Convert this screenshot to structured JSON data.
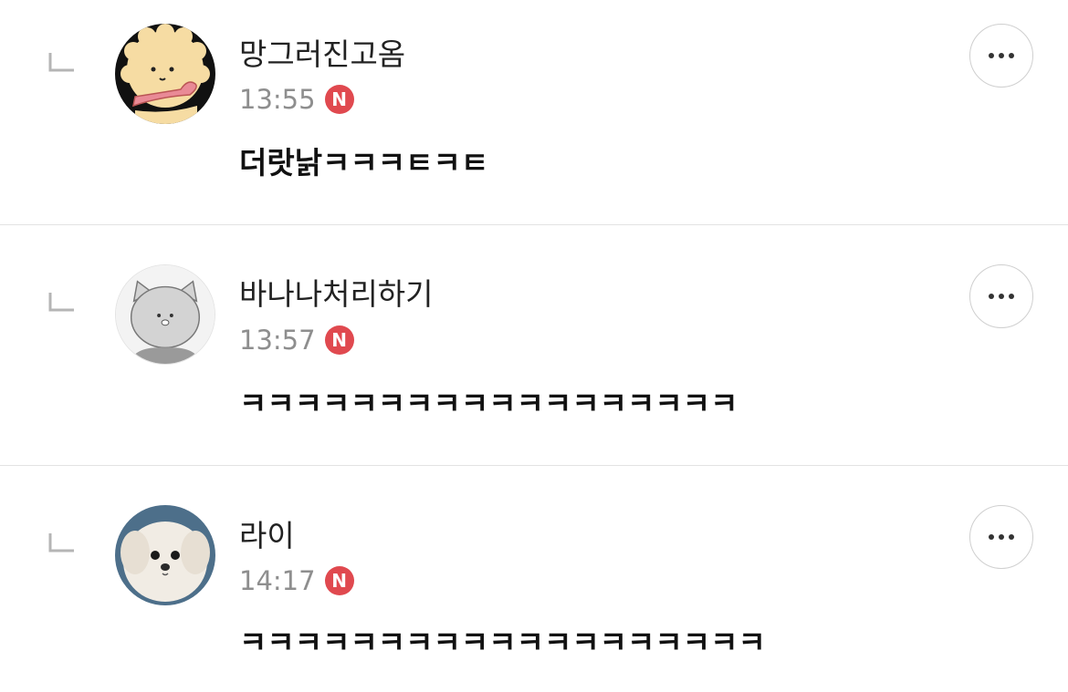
{
  "comments": [
    {
      "username": "망그러진고옴",
      "time": "13:55",
      "new_badge": "N",
      "text": "더랏낡ㅋㅋㅋㅌㅋㅌ",
      "avatar_icon": "cream-bear-avatar"
    },
    {
      "username": "바나나처리하기",
      "time": "13:57",
      "new_badge": "N",
      "text": "ㅋㅋㅋㅋㅋㅋㅋㅋㅋㅋㅋㅋㅋㅋㅋㅋㅋㅋ",
      "avatar_icon": "gray-cat-avatar"
    },
    {
      "username": "라이",
      "time": "14:17",
      "new_badge": "N",
      "text": "ㅋㅋㅋㅋㅋㅋㅋㅋㅋㅋㅋㅋㅋㅋㅋㅋㅋㅋㅋ",
      "avatar_icon": "white-puppy-avatar"
    }
  ],
  "colors": {
    "badge": "#e0494f",
    "divider": "#e3e3e3",
    "time": "#8e8e8e"
  }
}
